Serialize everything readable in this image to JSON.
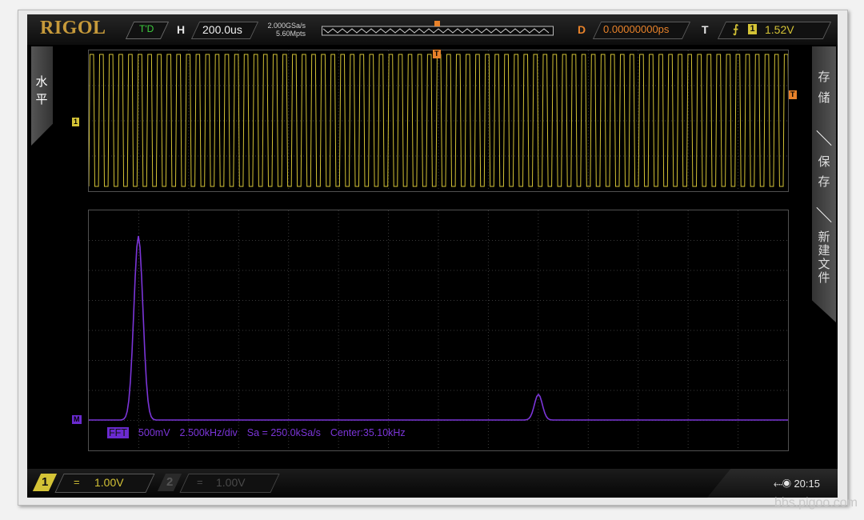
{
  "brand": "RIGOL",
  "top": {
    "mode": "T'D",
    "h_label": "H",
    "timebase": "200.0us",
    "sample_rate": "2.000GSa/s",
    "memory_depth": "5.60Mpts",
    "d_label": "D",
    "delay": "0.00000000ps",
    "t_label": "T",
    "trigger_channel": "1",
    "trigger_level": "1.52V"
  },
  "left_menu": [
    "水",
    "平"
  ],
  "right_menu": {
    "top": [
      "存",
      "储"
    ],
    "mid": [
      "保",
      "存"
    ],
    "bottom": [
      "新",
      "建",
      "文",
      "件"
    ]
  },
  "markers": {
    "trigger_top": "T",
    "trigger_right": "T",
    "channel1": "1",
    "math": "M"
  },
  "fft": {
    "tag": "FFT",
    "scale": "500mV",
    "span": "2.500kHz/div",
    "sample": "Sa = 250.0kSa/s",
    "center": "Center:35.10kHz"
  },
  "bottom": {
    "ch1_num": "1",
    "ch1_coupling": "=",
    "ch1_scale": "1.00V",
    "ch2_num": "2",
    "ch2_coupling": "=",
    "ch2_scale": "1.00V",
    "time": "20:15"
  },
  "colors": {
    "ch1": "#d4c336",
    "math": "#7b35d8",
    "trigger": "#e8822a",
    "grid": "#3a3a3a"
  },
  "credit": "bbs.pigoo.com"
}
